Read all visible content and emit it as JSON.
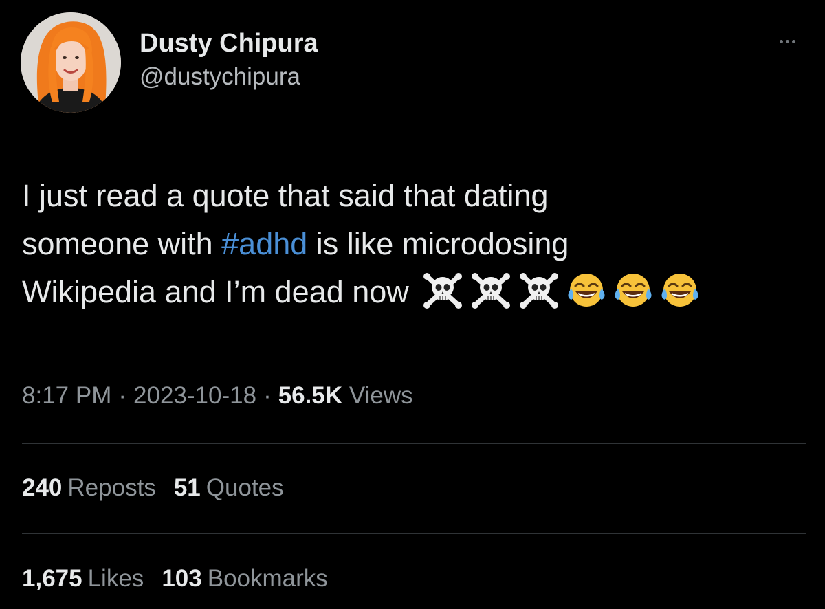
{
  "author": {
    "display_name": "Dusty Chipura",
    "handle": "@dustychipura"
  },
  "tweet": {
    "lines": [
      {
        "text": "I just read a quote that said that dating"
      },
      {
        "before": "someone with ",
        "hashtag": "#adhd",
        "after": " is like microdosing"
      },
      {
        "text": "Wikipedia and I’m dead now"
      }
    ],
    "emojis": [
      "skull-and-crossbones",
      "skull-and-crossbones",
      "skull-and-crossbones",
      "face-with-tears-of-joy",
      "face-with-tears-of-joy",
      "face-with-tears-of-joy"
    ]
  },
  "meta": {
    "time": "8:17 PM",
    "separator": "·",
    "date": "2023-10-18",
    "views_count": "56.5K",
    "views_label": "Views"
  },
  "stats": {
    "reposts": {
      "count": "240",
      "label": "Reposts"
    },
    "quotes": {
      "count": "51",
      "label": "Quotes"
    },
    "likes": {
      "count": "1,675",
      "label": "Likes"
    },
    "bookmarks": {
      "count": "103",
      "label": "Bookmarks"
    }
  },
  "colors": {
    "background": "#000000",
    "text": "#e7e9ea",
    "secondary": "#8f959a",
    "hashtag": "#4a8fd6",
    "divider": "#2f3336"
  }
}
